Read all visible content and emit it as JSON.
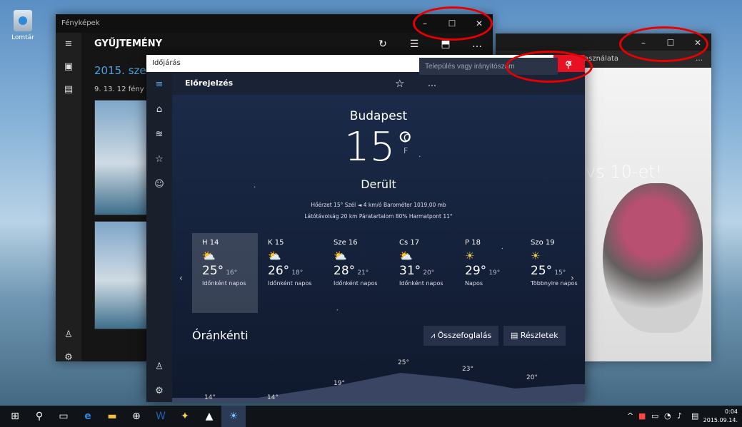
{
  "desktop": {
    "recycle_bin_label": "Lomtár"
  },
  "photos": {
    "title": "Fényképek",
    "header": "GYŰJTEMÉNY",
    "date": "2015. szep",
    "subtitle": "9. 13.  12 fény",
    "caption": [
      "–",
      "☐",
      "✕"
    ]
  },
  "win2": {
    "partial_title": "asználata",
    "hero": "vs 10-et!",
    "caption": [
      "–",
      "☐",
      "✕"
    ]
  },
  "weather": {
    "title": "Időjárás",
    "header": "Előrejelzés",
    "search_placeholder": "Település vagy irányítószám",
    "city": "Budapest",
    "temp": "15°",
    "unit_c": "C",
    "unit_f": "F",
    "condition": "Derült",
    "details1": "Hőérzet  15°     Szél  ◄ 4 km/ó     Barométer  1019,00 mb",
    "details2": "Látótávolság  20 km     Páratartalom  80%     Harmatpont  11°",
    "days": [
      {
        "name": "H 14",
        "icon": "⛅",
        "hi": "25°",
        "lo": "16°",
        "desc": "Időnként napos"
      },
      {
        "name": "K 15",
        "icon": "⛅",
        "hi": "26°",
        "lo": "18°",
        "desc": "Időnként napos"
      },
      {
        "name": "Sze 16",
        "icon": "⛅",
        "hi": "28°",
        "lo": "21°",
        "desc": "Időnként napos"
      },
      {
        "name": "Cs 17",
        "icon": "⛅",
        "hi": "31°",
        "lo": "20°",
        "desc": "Időnként napos"
      },
      {
        "name": "P 18",
        "icon": "☀",
        "hi": "29°",
        "lo": "19°",
        "desc": "Napos"
      },
      {
        "name": "Szo 19",
        "icon": "☀",
        "hi": "25°",
        "lo": "15°",
        "desc": "Többnyire napos"
      }
    ],
    "hourly_title": "Óránkénti",
    "summary_button": "Összefoglalás",
    "details_button": "Részletek",
    "hourly_temps": [
      "14°",
      "14°",
      "19°",
      "25°",
      "23°",
      "20°"
    ]
  },
  "taskbar": {
    "time": "0:04",
    "date": "2015.09.14."
  },
  "accent": {
    "ring": "#e60000",
    "close": "#e81123",
    "link": "#4aa3e0"
  }
}
